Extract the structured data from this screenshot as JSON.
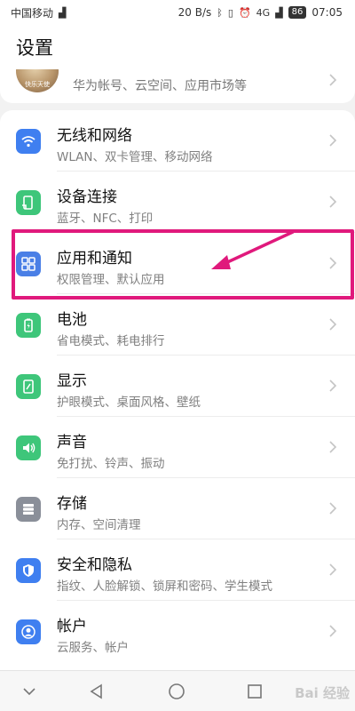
{
  "status_bar": {
    "carrier": "中国移动",
    "speed": "20 B/s",
    "network": "4G",
    "battery": "86",
    "time": "07:05"
  },
  "header": {
    "title": "设置"
  },
  "account": {
    "avatar_caption": "快乐天使",
    "subtitle": "华为帐号、云空间、应用市场等"
  },
  "items": [
    {
      "title": "无线和网络",
      "subtitle": "WLAN、双卡管理、移动网络",
      "icon": "wifi-icon",
      "color": "#3f7ff0"
    },
    {
      "title": "设备连接",
      "subtitle": "蓝牙、NFC、打印",
      "icon": "device-connect-icon",
      "color": "#3ec67a"
    },
    {
      "title": "应用和通知",
      "subtitle": "权限管理、默认应用",
      "icon": "apps-grid-icon",
      "color": "#4a7fe6"
    },
    {
      "title": "电池",
      "subtitle": "省电模式、耗电排行",
      "icon": "battery-icon",
      "color": "#3ec67a"
    },
    {
      "title": "显示",
      "subtitle": "护眼模式、桌面风格、壁纸",
      "icon": "display-icon",
      "color": "#3ec67a"
    },
    {
      "title": "声音",
      "subtitle": "免打扰、铃声、振动",
      "icon": "speaker-icon",
      "color": "#3ec67a"
    },
    {
      "title": "存储",
      "subtitle": "内存、空间清理",
      "icon": "storage-icon",
      "color": "#8a8f99"
    },
    {
      "title": "安全和隐私",
      "subtitle": "指纹、人脸解锁、锁屏和密码、学生模式",
      "icon": "shield-icon",
      "color": "#3f7ff0"
    },
    {
      "title": "帐户",
      "subtitle": "云服务、帐户",
      "icon": "account-icon",
      "color": "#3f7ff0"
    }
  ],
  "annotation": {
    "color": "#e0197c",
    "highlighted_item": "应用和通知"
  },
  "watermark": "Bai 经验"
}
